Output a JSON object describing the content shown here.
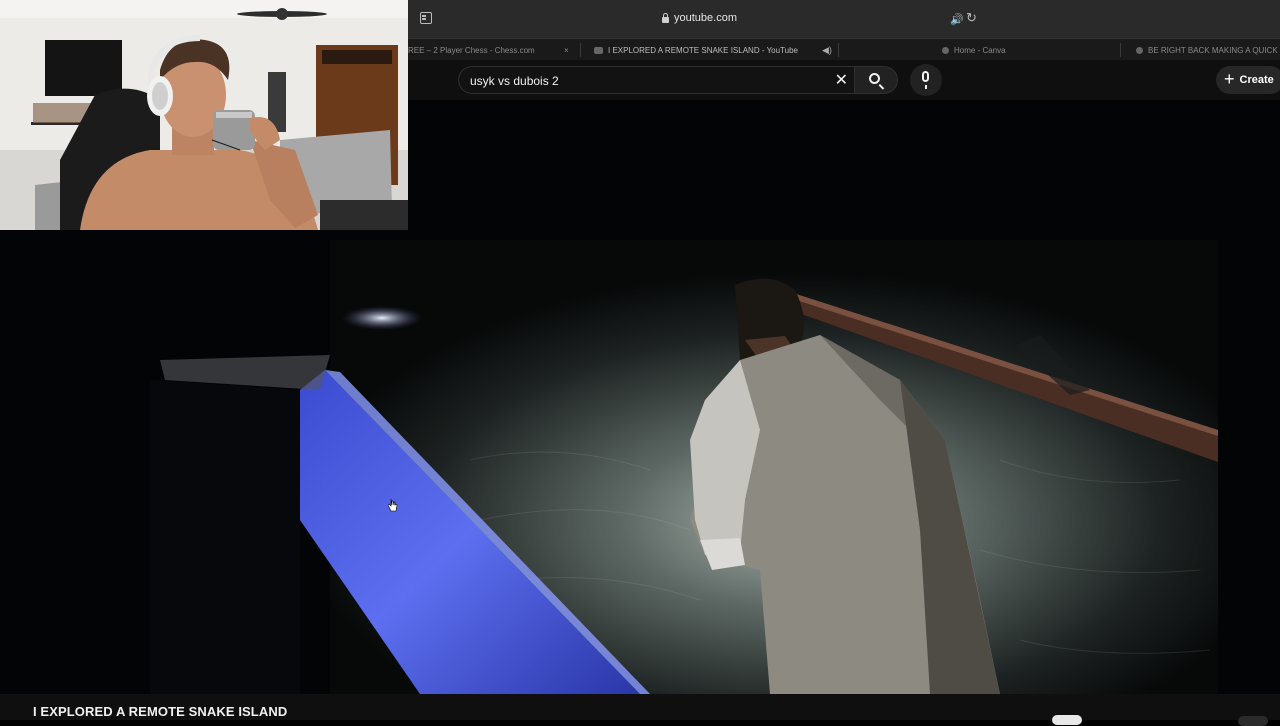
{
  "browser": {
    "url": "youtube.com",
    "tabs": [
      {
        "label": "REE – 2 Player Chess - Chess.com",
        "close": "×"
      },
      {
        "label": "I EXPLORED A REMOTE SNAKE ISLAND - YouTube",
        "audio_icon": "speaker-icon"
      },
      {
        "label": "Home - Canva"
      },
      {
        "label": "BE RIGHT BACK MAKING A QUICK"
      }
    ]
  },
  "youtube": {
    "search": {
      "value": "usyk vs dubois 2",
      "clear": "✕"
    },
    "create_label": "Create",
    "create_icon": "+"
  },
  "video": {
    "title": "I EXPLORED A REMOTE SNAKE ISLAND"
  },
  "icons": {
    "sidebar": "sidebar-icon",
    "lock": "lock-icon",
    "speaker": "🔊",
    "reload": "↻",
    "search": "search-icon",
    "mic": "mic-icon"
  },
  "colors": {
    "accent": "#3f8df0",
    "yt_bg": "#0f0f0f"
  }
}
